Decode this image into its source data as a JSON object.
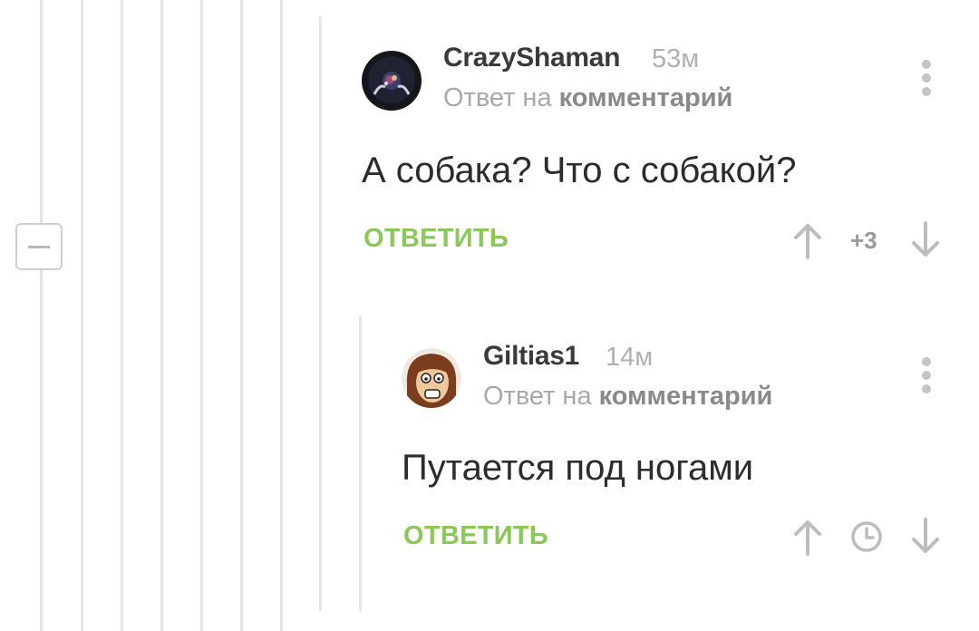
{
  "comments": [
    {
      "username": "CrazyShaman",
      "time": "53м",
      "reply_prefix": "Ответ на",
      "reply_target": "комментарий",
      "text": "А собака? Что с собакой?",
      "reply_label": "ОТВЕТИТЬ",
      "rating": "+3"
    },
    {
      "username": "Giltias1",
      "time": "14м",
      "reply_prefix": "Ответ на",
      "reply_target": "комментарий",
      "text": "Путается под ногами",
      "reply_label": "ОТВЕТИТЬ"
    }
  ],
  "colors": {
    "accent_green": "#8ac858",
    "thread_line": "#e6e6e6",
    "text_dark": "#2c2c2c",
    "text_muted": "#a9a9a9"
  },
  "icons": [
    "collapse-minus-icon",
    "more-vertical-icon",
    "arrow-up-icon",
    "arrow-down-icon",
    "clock-icon"
  ]
}
